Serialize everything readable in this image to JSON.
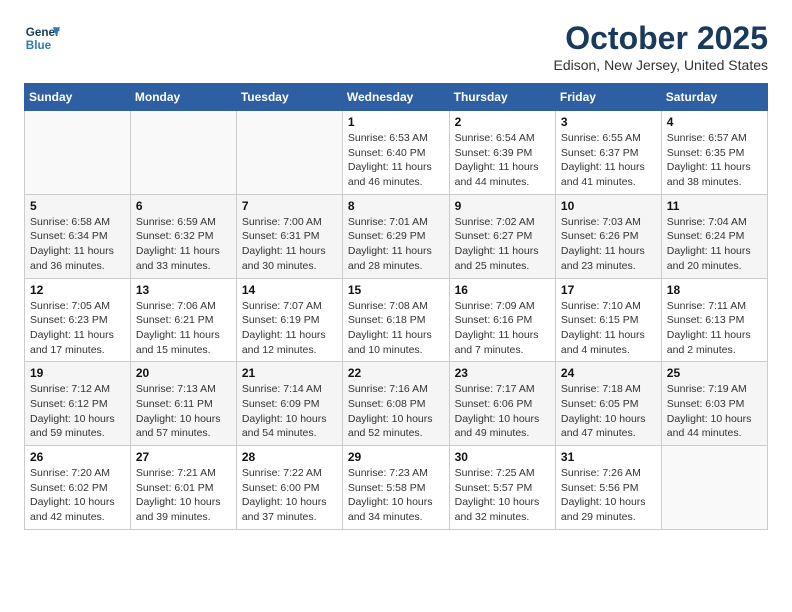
{
  "header": {
    "logo_line1": "General",
    "logo_line2": "Blue",
    "month": "October 2025",
    "location": "Edison, New Jersey, United States"
  },
  "weekdays": [
    "Sunday",
    "Monday",
    "Tuesday",
    "Wednesday",
    "Thursday",
    "Friday",
    "Saturday"
  ],
  "weeks": [
    [
      {
        "day": "",
        "info": ""
      },
      {
        "day": "",
        "info": ""
      },
      {
        "day": "",
        "info": ""
      },
      {
        "day": "1",
        "info": "Sunrise: 6:53 AM\nSunset: 6:40 PM\nDaylight: 11 hours\nand 46 minutes."
      },
      {
        "day": "2",
        "info": "Sunrise: 6:54 AM\nSunset: 6:39 PM\nDaylight: 11 hours\nand 44 minutes."
      },
      {
        "day": "3",
        "info": "Sunrise: 6:55 AM\nSunset: 6:37 PM\nDaylight: 11 hours\nand 41 minutes."
      },
      {
        "day": "4",
        "info": "Sunrise: 6:57 AM\nSunset: 6:35 PM\nDaylight: 11 hours\nand 38 minutes."
      }
    ],
    [
      {
        "day": "5",
        "info": "Sunrise: 6:58 AM\nSunset: 6:34 PM\nDaylight: 11 hours\nand 36 minutes."
      },
      {
        "day": "6",
        "info": "Sunrise: 6:59 AM\nSunset: 6:32 PM\nDaylight: 11 hours\nand 33 minutes."
      },
      {
        "day": "7",
        "info": "Sunrise: 7:00 AM\nSunset: 6:31 PM\nDaylight: 11 hours\nand 30 minutes."
      },
      {
        "day": "8",
        "info": "Sunrise: 7:01 AM\nSunset: 6:29 PM\nDaylight: 11 hours\nand 28 minutes."
      },
      {
        "day": "9",
        "info": "Sunrise: 7:02 AM\nSunset: 6:27 PM\nDaylight: 11 hours\nand 25 minutes."
      },
      {
        "day": "10",
        "info": "Sunrise: 7:03 AM\nSunset: 6:26 PM\nDaylight: 11 hours\nand 23 minutes."
      },
      {
        "day": "11",
        "info": "Sunrise: 7:04 AM\nSunset: 6:24 PM\nDaylight: 11 hours\nand 20 minutes."
      }
    ],
    [
      {
        "day": "12",
        "info": "Sunrise: 7:05 AM\nSunset: 6:23 PM\nDaylight: 11 hours\nand 17 minutes."
      },
      {
        "day": "13",
        "info": "Sunrise: 7:06 AM\nSunset: 6:21 PM\nDaylight: 11 hours\nand 15 minutes."
      },
      {
        "day": "14",
        "info": "Sunrise: 7:07 AM\nSunset: 6:19 PM\nDaylight: 11 hours\nand 12 minutes."
      },
      {
        "day": "15",
        "info": "Sunrise: 7:08 AM\nSunset: 6:18 PM\nDaylight: 11 hours\nand 10 minutes."
      },
      {
        "day": "16",
        "info": "Sunrise: 7:09 AM\nSunset: 6:16 PM\nDaylight: 11 hours\nand 7 minutes."
      },
      {
        "day": "17",
        "info": "Sunrise: 7:10 AM\nSunset: 6:15 PM\nDaylight: 11 hours\nand 4 minutes."
      },
      {
        "day": "18",
        "info": "Sunrise: 7:11 AM\nSunset: 6:13 PM\nDaylight: 11 hours\nand 2 minutes."
      }
    ],
    [
      {
        "day": "19",
        "info": "Sunrise: 7:12 AM\nSunset: 6:12 PM\nDaylight: 10 hours\nand 59 minutes."
      },
      {
        "day": "20",
        "info": "Sunrise: 7:13 AM\nSunset: 6:11 PM\nDaylight: 10 hours\nand 57 minutes."
      },
      {
        "day": "21",
        "info": "Sunrise: 7:14 AM\nSunset: 6:09 PM\nDaylight: 10 hours\nand 54 minutes."
      },
      {
        "day": "22",
        "info": "Sunrise: 7:16 AM\nSunset: 6:08 PM\nDaylight: 10 hours\nand 52 minutes."
      },
      {
        "day": "23",
        "info": "Sunrise: 7:17 AM\nSunset: 6:06 PM\nDaylight: 10 hours\nand 49 minutes."
      },
      {
        "day": "24",
        "info": "Sunrise: 7:18 AM\nSunset: 6:05 PM\nDaylight: 10 hours\nand 47 minutes."
      },
      {
        "day": "25",
        "info": "Sunrise: 7:19 AM\nSunset: 6:03 PM\nDaylight: 10 hours\nand 44 minutes."
      }
    ],
    [
      {
        "day": "26",
        "info": "Sunrise: 7:20 AM\nSunset: 6:02 PM\nDaylight: 10 hours\nand 42 minutes."
      },
      {
        "day": "27",
        "info": "Sunrise: 7:21 AM\nSunset: 6:01 PM\nDaylight: 10 hours\nand 39 minutes."
      },
      {
        "day": "28",
        "info": "Sunrise: 7:22 AM\nSunset: 6:00 PM\nDaylight: 10 hours\nand 37 minutes."
      },
      {
        "day": "29",
        "info": "Sunrise: 7:23 AM\nSunset: 5:58 PM\nDaylight: 10 hours\nand 34 minutes."
      },
      {
        "day": "30",
        "info": "Sunrise: 7:25 AM\nSunset: 5:57 PM\nDaylight: 10 hours\nand 32 minutes."
      },
      {
        "day": "31",
        "info": "Sunrise: 7:26 AM\nSunset: 5:56 PM\nDaylight: 10 hours\nand 29 minutes."
      },
      {
        "day": "",
        "info": ""
      }
    ]
  ]
}
